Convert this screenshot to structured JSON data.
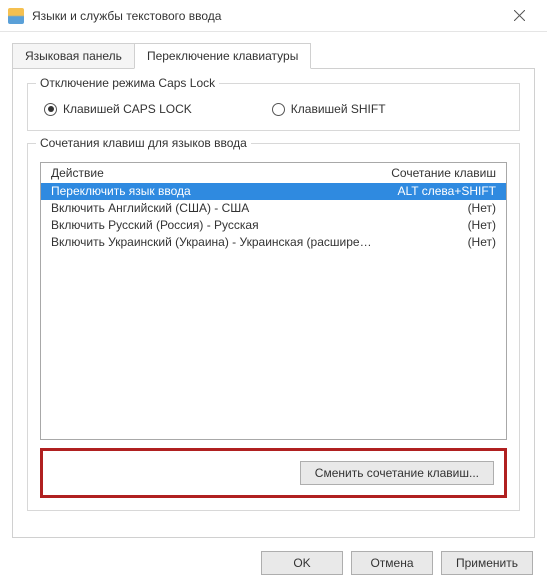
{
  "title": "Языки и службы текстового ввода",
  "tabs": {
    "language_bar": "Языковая панель",
    "keyboard_switch": "Переключение клавиатуры"
  },
  "capslock_group": {
    "legend": "Отключение режима Caps Lock",
    "caps_radio": "Клавишей CAPS LOCK",
    "shift_radio": "Клавишей SHIFT"
  },
  "hotkeys_group": {
    "legend": "Сочетания клавиш для языков ввода",
    "header_action": "Действие",
    "header_hotkey": "Сочетание клавиш",
    "rows": [
      {
        "action": "Переключить язык ввода",
        "hotkey": "ALT слева+SHIFT"
      },
      {
        "action": "Включить Английский (США) - США",
        "hotkey": "(Нет)"
      },
      {
        "action": "Включить Русский (Россия) - Русская",
        "hotkey": "(Нет)"
      },
      {
        "action": "Включить Украинский (Украина) - Украинская (расширенная)",
        "hotkey": "(Нет)"
      }
    ],
    "change_button": "Сменить сочетание клавиш..."
  },
  "footer": {
    "ok": "OK",
    "cancel": "Отмена",
    "apply": "Применить"
  }
}
